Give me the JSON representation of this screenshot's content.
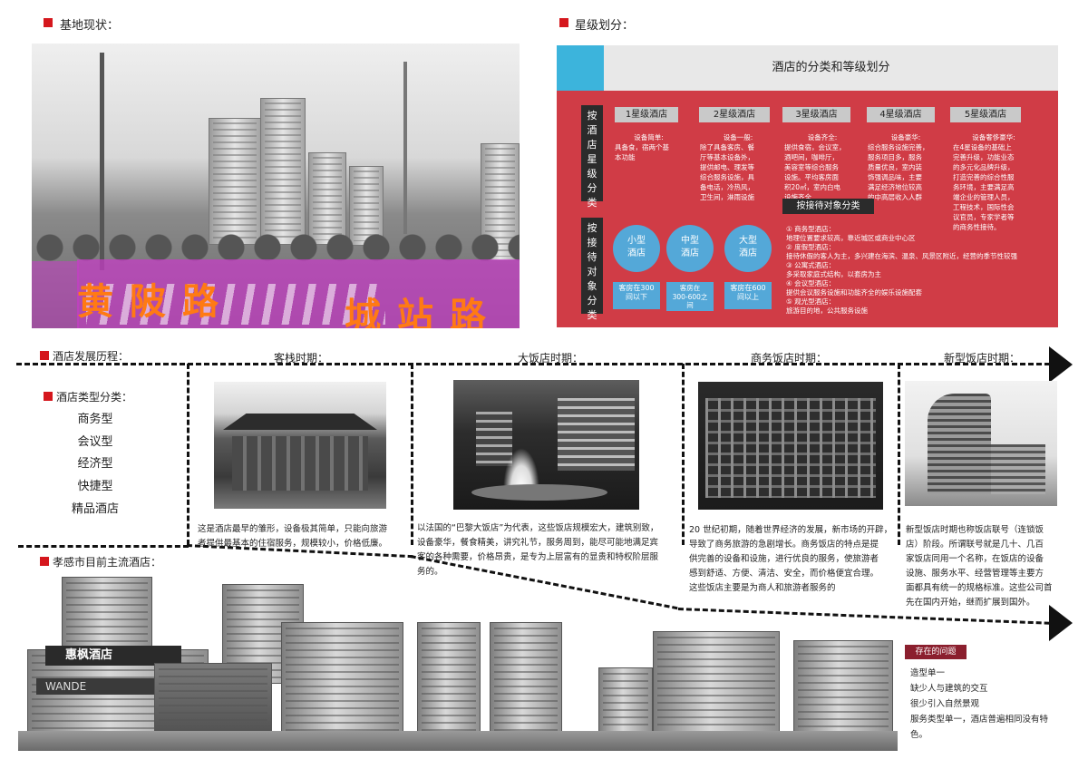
{
  "sections": {
    "site_status": "基地现状：",
    "star_rating": "星级划分：",
    "history": "酒店发展历程：",
    "hotel_types": "酒店类型分类：",
    "xiaogan_hotels": "孝感市目前主流酒店："
  },
  "site_photo": {
    "road_left": "黄陂路",
    "road_right": "城站路"
  },
  "rating_panel": {
    "title": "酒店的分类和等级划分",
    "by_star_label": [
      "按",
      "酒",
      "店",
      "星",
      "级",
      "分",
      "类"
    ],
    "by_guest_label": [
      "按",
      "接",
      "待",
      "对",
      "象",
      "分",
      "类"
    ],
    "stars": [
      {
        "name": "1星级酒店",
        "desc": [
          "设备简单:",
          "具备食，宿两个基",
          "本功能"
        ]
      },
      {
        "name": "2星级酒店",
        "desc": [
          "设备一般:",
          "除了具备客房、餐",
          "厅等基本设备外，",
          "提供邮电、理发等",
          "综合服务设施，具",
          "备电话，冷热风，",
          "卫生间，淋雨设施"
        ]
      },
      {
        "name": "3星级酒店",
        "desc": [
          "设备齐全:",
          "提供食宿，会议室，",
          "酒吧间，咖啡厅，",
          "美容室等综合服务",
          "设施。平均客房面",
          "积20㎡，室内白电",
          "设施齐全"
        ]
      },
      {
        "name": "4星级酒店",
        "desc": [
          "设备豪华:",
          "综合服务设施完善，",
          "服务项目多，服务",
          "质量优良，室内装",
          "饰强调品味，主要",
          "满足经济地位较高",
          "的中高层收入人群"
        ]
      },
      {
        "name": "5星级酒店",
        "desc": [
          "设备奢侈豪华:",
          "在4星设备的基础上",
          "完善升级，功能业态",
          "的多元化品牌升级，",
          "打造完善的综合性服",
          "务环境，主要满足高",
          "端企业的管理人员，",
          "工程技术，国际性会",
          "议官员，专家学者等",
          "的商务性接待。"
        ]
      }
    ],
    "sizes": [
      {
        "name": [
          "小型",
          "酒店"
        ],
        "rooms": [
          "客房在300",
          "间以下"
        ]
      },
      {
        "name": [
          "中型",
          "酒店"
        ],
        "rooms": [
          "客房在",
          "300-600之",
          "间"
        ]
      },
      {
        "name": [
          "大型",
          "酒店"
        ],
        "rooms": [
          "客房在600",
          "间以上"
        ]
      }
    ],
    "guest_heading": "按接待对象分类",
    "guest_types": [
      "①  商务型酒店：",
      "地理位置要求较高，靠近城区或商业中心区",
      "②  度假型酒店：",
      "接待休假的客人为主，多兴建在海滨、温泉、风景区附近，经营的季节性较强",
      "③  公寓式酒店：",
      "多采取家庭式结构，以套房为主",
      "④  会议型酒店：",
      "提供会议服务设施和功能齐全的娱乐设施配套",
      "⑤  观光型酒店：",
      "旅游目的地，公共服务设施"
    ]
  },
  "eras": [
    {
      "name": "客栈时期：",
      "text": [
        "这是酒店最早的雏形，设备极其简单，只能向旅游",
        "者提供最基本的住宿服务，规模较小，价格低廉。"
      ]
    },
    {
      "name": "大饭店时期：",
      "text": [
        "以法国的“巴黎大饭店”为代表，这些饭店规模宏大，建筑别致，",
        "设备豪华，餐食精美，讲究礼节，服务周到，能尽可能地满足宾",
        "客的各种需要，价格昂贵，是专为上层富有的显贵和特权阶层服",
        "务的。"
      ]
    },
    {
      "name": "商务饭店时期：",
      "text": [
        "20 世纪初期，随着世界经济的发展，新市场的开辟，",
        "导致了商务旅游的急剧增长。商务饭店的特点是提",
        "供完善的设备和设施，进行优良的服务，使旅游者",
        "感到舒适、方便、清洁、安全，而价格便宜合理。",
        "这些饭店主要是为商人和旅游者服务的"
      ]
    },
    {
      "name": "新型饭店时期：",
      "text": [
        "新型饭店时期也称饭店联号（连锁饭",
        "店）阶段。所谓联号就是几十、几百",
        "家饭店同用一个名称，在饭店的设备",
        "设施、服务水平、经营管理等主要方",
        "面都具有统一的规格标准。这些公司首",
        "先在国内开始，继而扩展到国外。"
      ]
    }
  ],
  "hotel_type_list": [
    "商务型",
    "会议型",
    "经济型",
    "快捷型",
    "精品酒店"
  ],
  "collage": {
    "sign_top": "惠枫酒店",
    "sign_bottom": "WANDE"
  },
  "problems": {
    "title": "存在的问题",
    "items": [
      "造型单一",
      "缺少人与建筑的交互",
      "很少引入自然景观",
      "服务类型单一，酒店普遍相同没有特",
      "色。"
    ]
  },
  "colors": {
    "accent_red": "#d5171d",
    "panel_red": "#d03c46",
    "cyan": "#3cb4dc",
    "circle_blue": "#54a8d8",
    "road_label": "#ff7a14",
    "overlay_pink": "#c83cc8",
    "issue_bg": "#8b1f2e"
  }
}
